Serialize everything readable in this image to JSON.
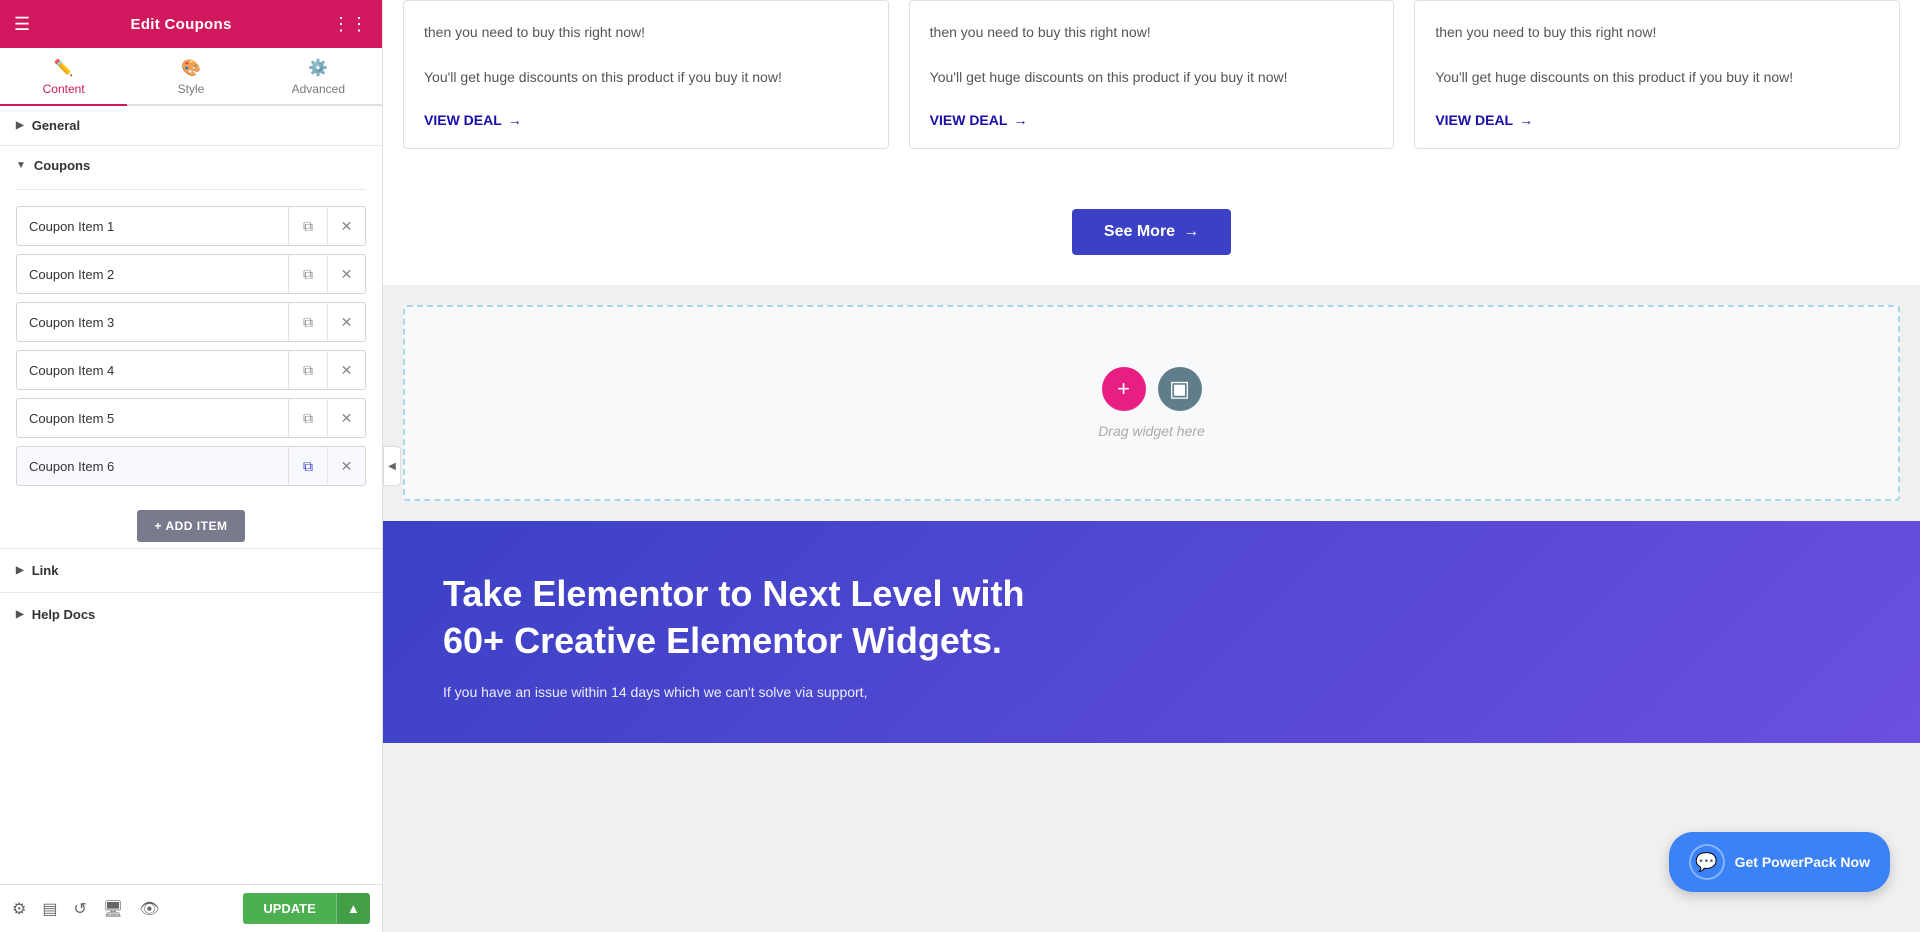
{
  "panel": {
    "title": "Edit Coupons",
    "tabs": [
      {
        "id": "content",
        "label": "Content",
        "icon": "✏️",
        "active": true
      },
      {
        "id": "style",
        "label": "Style",
        "icon": "🎨",
        "active": false
      },
      {
        "id": "advanced",
        "label": "Advanced",
        "icon": "⚙️",
        "active": false
      }
    ],
    "general_section": "General",
    "coupons_section": "Coupons",
    "coupon_items": [
      {
        "id": 1,
        "label": "Coupon Item 1"
      },
      {
        "id": 2,
        "label": "Coupon Item 2"
      },
      {
        "id": 3,
        "label": "Coupon Item 3"
      },
      {
        "id": 4,
        "label": "Coupon Item 4"
      },
      {
        "id": 5,
        "label": "Coupon Item 5"
      },
      {
        "id": 6,
        "label": "Coupon Item 6"
      }
    ],
    "add_item_label": "+ ADD ITEM",
    "link_section": "Link",
    "help_docs_section": "Help Docs",
    "update_button": "UPDATE",
    "footer_icons": [
      "settings",
      "layers",
      "history",
      "desktop",
      "preview"
    ]
  },
  "main": {
    "cards": [
      {
        "text1": "then you need to buy this right now!",
        "text2": "You'll get huge discounts on this product if you buy it now!",
        "view_deal": "VIEW DEAL"
      },
      {
        "text1": "then you need to buy this right now!",
        "text2": "You'll get huge discounts on this product if you buy it now!",
        "view_deal": "VIEW DEAL"
      },
      {
        "text1": "then you need to buy this right now!",
        "text2": "You'll get huge discounts on this product if you buy it now!",
        "view_deal": "VIEW DEAL"
      }
    ],
    "see_more": "See More",
    "drag_widget_text": "Drag widget here",
    "promo": {
      "heading1": "Take Elementor to Next Level with",
      "heading2": "60+ Creative Elementor Widgets.",
      "body": "If you have an issue within 14 days which we can't solve via support,"
    },
    "get_powerpack": "Get PowerPack Now"
  },
  "colors": {
    "brand_pink": "#d1175e",
    "brand_blue": "#3b41c5",
    "link_blue": "#1a0dab",
    "green": "#4caf50",
    "chat_blue": "#3b82f6"
  }
}
